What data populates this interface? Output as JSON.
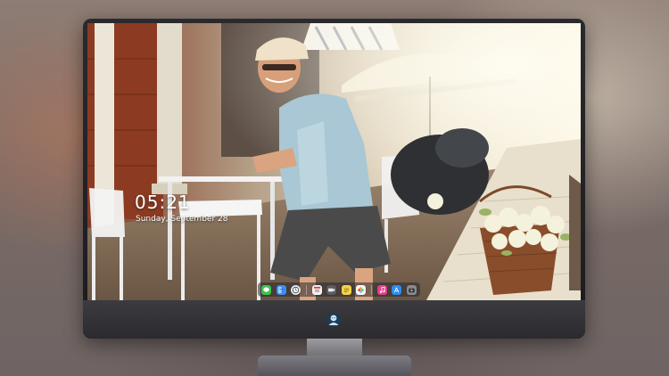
{
  "lock_screen": {
    "time": "05:21",
    "date": "Sunday, September 28"
  },
  "dock": {
    "items": [
      {
        "name": "Messages",
        "icon": "messages-icon",
        "color": "#3fc34a"
      },
      {
        "name": "Finder",
        "icon": "finder-icon",
        "color": "#3c8df2"
      },
      {
        "name": "Clock",
        "icon": "clock-icon",
        "color": "#e8e8e8"
      },
      {
        "name": "Calendar",
        "icon": "calendar-icon",
        "color": "#f4f4f4"
      },
      {
        "name": "Claquette",
        "icon": "video-icon",
        "color": "#5a5a62"
      },
      {
        "name": "Notes",
        "icon": "notes-icon",
        "color": "#f5d24a"
      },
      {
        "name": "Photos",
        "icon": "photos-icon",
        "color": "#f7f7f7"
      },
      {
        "name": "Music",
        "icon": "music-icon",
        "color": "#e2408a"
      },
      {
        "name": "App Store",
        "icon": "app-store-icon",
        "color": "#2f8cf0"
      },
      {
        "name": "Camera",
        "icon": "camera-icon",
        "color": "#8a8a92"
      }
    ]
  },
  "colors": {
    "bezel": "#1c1c20",
    "chin": "#3b3b40",
    "stand": "#8a898e"
  }
}
